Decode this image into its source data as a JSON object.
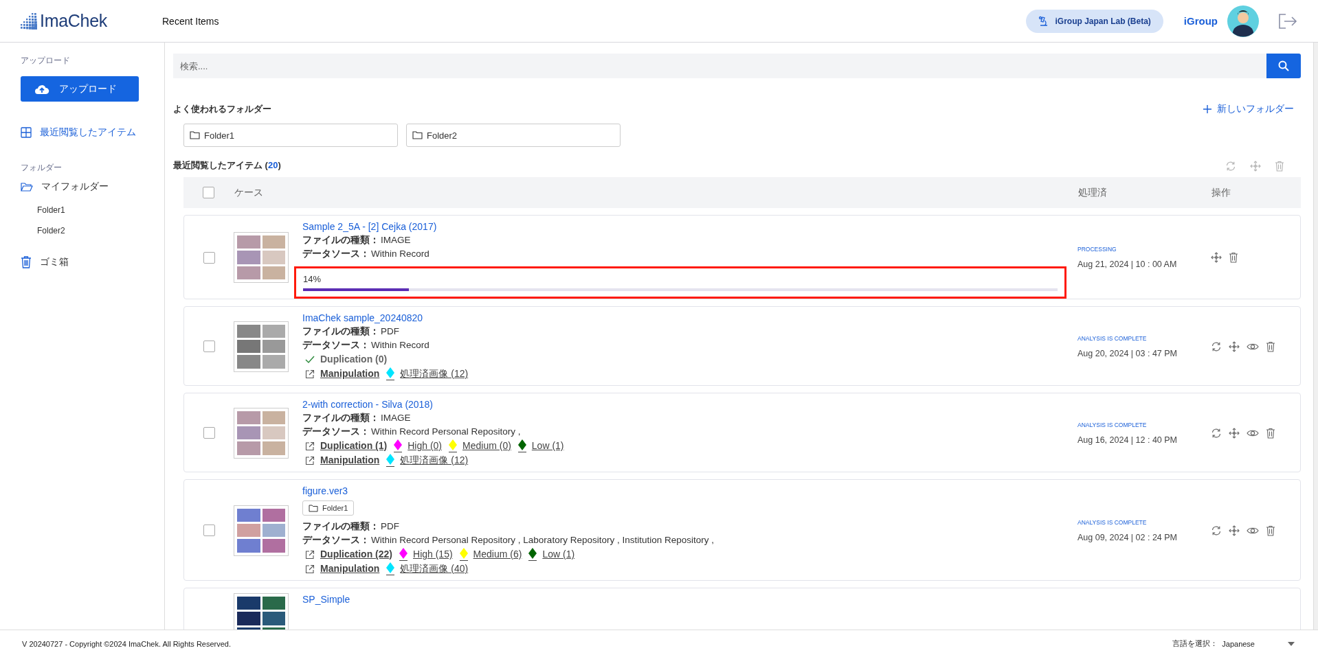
{
  "header": {
    "logo": "ImaChek",
    "page_title": "Recent Items",
    "lab_badge": "iGroup Japan Lab (Beta)",
    "user": "iGroup"
  },
  "sidebar": {
    "upload_label": "アップロード",
    "upload_button": "アップロード",
    "nav": [
      {
        "label": "最近閲覧したアイテム",
        "selected": true
      }
    ],
    "folders_label": "フォルダー",
    "folders": [
      {
        "label": "マイフォルダー",
        "children": [
          {
            "label": "Folder1"
          },
          {
            "label": "Folder2"
          }
        ]
      }
    ],
    "trash": "ゴミ箱"
  },
  "search": {
    "placeholder": "検索...."
  },
  "favorites": {
    "title": "よく使われるフォルダー",
    "new_folder": "新しいフォルダー",
    "folders": [
      "Folder1",
      "Folder2"
    ]
  },
  "recent": {
    "title": "最近閲覧したアイテム",
    "count_open": "(",
    "count": "20",
    "count_close": ")",
    "columns": [
      "ケース",
      "処理済",
      "操作"
    ],
    "all_checked": false,
    "rows": [
      {
        "checked": false,
        "title": "Sample 2_5A - [2] Cejka (2017)",
        "file_type_label": "ファイルの種類：",
        "file_type": "IMAGE",
        "source_label": "データソース：",
        "source": "Within Record",
        "progress": {
          "text": "14%",
          "level": 0.14,
          "highlighted": true
        },
        "status": "PROCESSING",
        "date": "Aug 21, 2024 | 10 : 00 AM",
        "actions": [
          {
            "kind": "move"
          },
          {
            "kind": "delete"
          }
        ]
      },
      {
        "checked": false,
        "title": "ImaChek sample_20240820",
        "file_type_label": "ファイルの種類：",
        "file_type": "PDF",
        "source_label": "データソース：",
        "source": "Within Record",
        "results": [
          {
            "kind": "check",
            "label": "Duplication (0)"
          },
          {
            "kind": "link",
            "label": "Manipulation",
            "tags": [
              {
                "text": "処理済画像 (12)",
                "color": "#00e5ff"
              }
            ]
          }
        ],
        "status": "ANALYSIS IS COMPLETE",
        "date": "Aug 20, 2024 | 03 : 47 PM",
        "actions": [
          {
            "kind": "reload"
          },
          {
            "kind": "move"
          },
          {
            "kind": "view"
          },
          {
            "kind": "delete"
          }
        ]
      },
      {
        "checked": false,
        "title": "2-with correction - Silva (2018)",
        "file_type_label": "ファイルの種類：",
        "file_type": "IMAGE",
        "source_label": "データソース：",
        "source": "Within Record Personal Repository ,",
        "results": [
          {
            "kind": "link",
            "label": "Duplication (1)",
            "tags": [
              {
                "text": "High (0)",
                "color": "#ff00ff"
              },
              {
                "text": "Medium (0)",
                "color": "#ffff00"
              },
              {
                "text": "Low (1)",
                "color": "#006400"
              }
            ]
          },
          {
            "kind": "link",
            "label": "Manipulation",
            "tags": [
              {
                "text": "処理済画像 (12)",
                "color": "#00e5ff"
              }
            ]
          }
        ],
        "status": "ANALYSIS IS COMPLETE",
        "date": "Aug 16, 2024 | 12 : 40 PM",
        "actions": [
          {
            "kind": "reload"
          },
          {
            "kind": "move"
          },
          {
            "kind": "view"
          },
          {
            "kind": "delete"
          }
        ]
      },
      {
        "checked": false,
        "title": "figure.ver3",
        "folder_tag": "Folder1",
        "file_type_label": "ファイルの種類：",
        "file_type": "PDF",
        "source_label": "データソース：",
        "source": "Within Record Personal Repository , Laboratory Repository , Institution Repository ,",
        "results": [
          {
            "kind": "link",
            "label": "Duplication (22)",
            "tags": [
              {
                "text": "High (15)",
                "color": "#ff00ff"
              },
              {
                "text": "Medium (6)",
                "color": "#ffff00"
              },
              {
                "text": "Low (1)",
                "color": "#006400"
              }
            ]
          },
          {
            "kind": "link",
            "label": "Manipulation",
            "tags": [
              {
                "text": "処理済画像 (40)",
                "color": "#00e5ff"
              }
            ]
          }
        ],
        "status": "ANALYSIS IS COMPLETE",
        "date": "Aug 09, 2024 | 02 : 24 PM",
        "actions": [
          {
            "kind": "reload"
          },
          {
            "kind": "move"
          },
          {
            "kind": "view"
          },
          {
            "kind": "delete"
          }
        ]
      },
      {
        "title": "SP_Simple"
      }
    ]
  },
  "footer": {
    "copyright": "V 20240727 - Copyright ©2024 ImaChek. All Rights Reserved.",
    "language_label": "言語を選択：",
    "language": "Japanese"
  }
}
